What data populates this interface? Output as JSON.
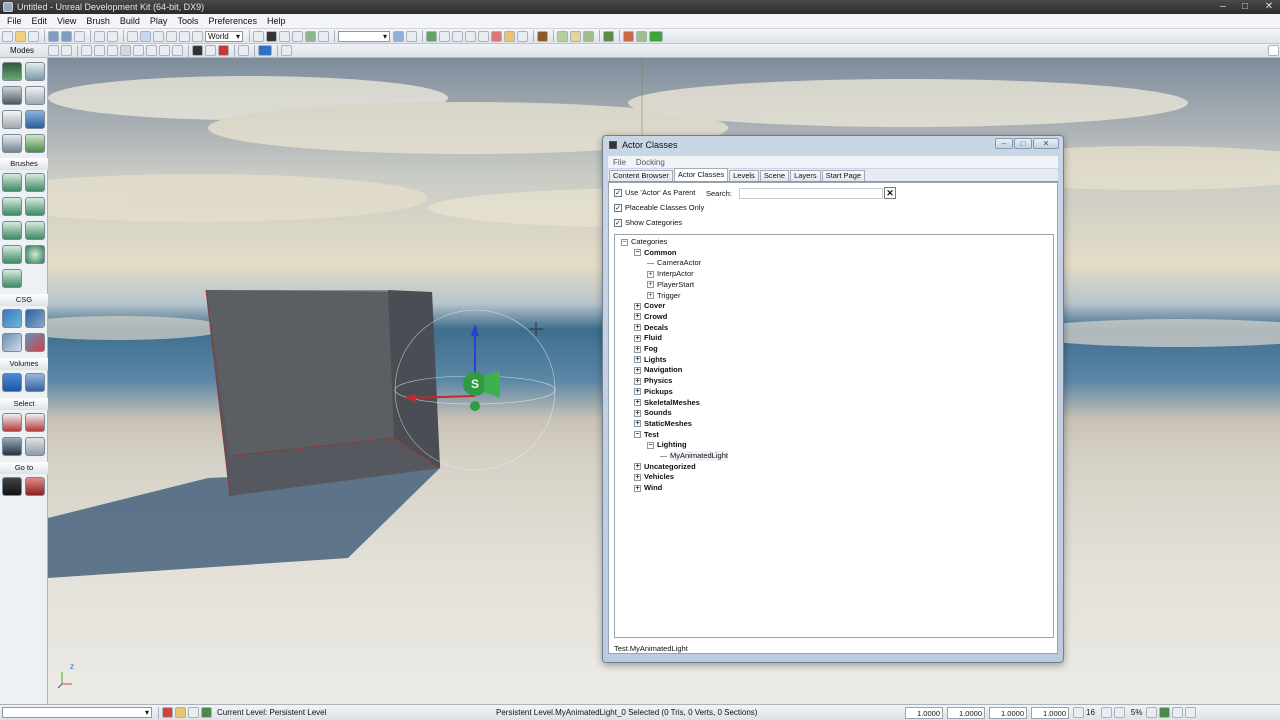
{
  "window": {
    "title": "Untitled - Unreal Development Kit (64-bit, DX9)"
  },
  "menu": [
    "File",
    "Edit",
    "View",
    "Brush",
    "Build",
    "Play",
    "Tools",
    "Preferences",
    "Help"
  ],
  "toolbar": {
    "coordinate_system": "World"
  },
  "modes_panel": {
    "label": "Modes",
    "sections": [
      "Brushes",
      "CSG",
      "Volumes",
      "Select",
      "Go to"
    ]
  },
  "viewport": {
    "axis_label": "z"
  },
  "actor_classes": {
    "title": "Actor Classes",
    "menu": [
      "File",
      "Docking"
    ],
    "tabs": [
      "Content Browser",
      "Actor Classes",
      "Levels",
      "Scene",
      "Layers",
      "Start Page"
    ],
    "active_tab": "Actor Classes",
    "options": [
      {
        "label": "Use 'Actor' As Parent",
        "checked": true
      },
      {
        "label": "Placeable Classes Only",
        "checked": true
      },
      {
        "label": "Show Categories",
        "checked": true
      }
    ],
    "search": {
      "label": "Search:",
      "value": "",
      "placeholder": ""
    },
    "tree": [
      {
        "label": "Categories",
        "level": 0,
        "node": "expanded",
        "bold": false
      },
      {
        "label": "Common",
        "level": 1,
        "node": "expanded",
        "bold": true
      },
      {
        "label": "CameraActor",
        "level": 2,
        "node": "leaf",
        "bold": false
      },
      {
        "label": "InterpActor",
        "level": 2,
        "node": "collapsed",
        "bold": false
      },
      {
        "label": "PlayerStart",
        "level": 2,
        "node": "collapsed",
        "bold": false
      },
      {
        "label": "Trigger",
        "level": 2,
        "node": "collapsed",
        "bold": false
      },
      {
        "label": "Cover",
        "level": 1,
        "node": "collapsed",
        "bold": true
      },
      {
        "label": "Crowd",
        "level": 1,
        "node": "collapsed",
        "bold": true
      },
      {
        "label": "Decals",
        "level": 1,
        "node": "collapsed",
        "bold": true
      },
      {
        "label": "Fluid",
        "level": 1,
        "node": "collapsed",
        "bold": true
      },
      {
        "label": "Fog",
        "level": 1,
        "node": "collapsed",
        "bold": true
      },
      {
        "label": "Lights",
        "level": 1,
        "node": "collapsed",
        "bold": true
      },
      {
        "label": "Navigation",
        "level": 1,
        "node": "collapsed",
        "bold": true
      },
      {
        "label": "Physics",
        "level": 1,
        "node": "collapsed",
        "bold": true
      },
      {
        "label": "Pickups",
        "level": 1,
        "node": "collapsed",
        "bold": true
      },
      {
        "label": "SkeletalMeshes",
        "level": 1,
        "node": "collapsed",
        "bold": true
      },
      {
        "label": "Sounds",
        "level": 1,
        "node": "collapsed",
        "bold": true
      },
      {
        "label": "StaticMeshes",
        "level": 1,
        "node": "collapsed",
        "bold": true
      },
      {
        "label": "Test",
        "level": 1,
        "node": "expanded",
        "bold": true
      },
      {
        "label": "Lighting",
        "level": 2,
        "node": "expanded",
        "bold": true
      },
      {
        "label": "MyAnimatedLight",
        "level": 3,
        "node": "leaf",
        "bold": false,
        "selected": true
      },
      {
        "label": "Uncategorized",
        "level": 1,
        "node": "collapsed",
        "bold": true
      },
      {
        "label": "Vehicles",
        "level": 1,
        "node": "collapsed",
        "bold": true
      },
      {
        "label": "Wind",
        "level": 1,
        "node": "collapsed",
        "bold": true
      }
    ],
    "selected_path": "Test.MyAnimatedLight"
  },
  "statusbar": {
    "current_level": "Current Level:  Persistent Level",
    "selection": "Persistent Level.MyAnimatedLight_0 Selected (0 Tris, 0 Verts, 0 Sections)",
    "fields": [
      "1.0000",
      "1.0000",
      "1.0000",
      "1.0000"
    ],
    "grid_size": "16",
    "scale_percent": "5%"
  }
}
